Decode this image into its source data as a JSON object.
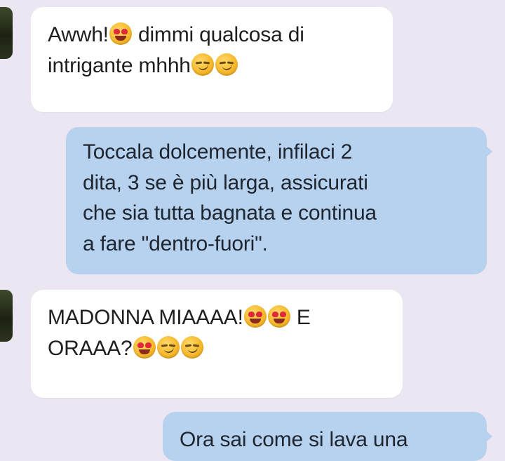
{
  "messages": [
    {
      "direction": "received",
      "lines": [
        [
          "Awwh!",
          "emoji:heart-eyes",
          " dimmi qualcosa di"
        ],
        [
          "intrigante mhhh",
          "emoji:smirk",
          "emoji:smirk"
        ]
      ]
    },
    {
      "direction": "sent",
      "lines": [
        [
          "Toccala dolcemente, infilaci 2"
        ],
        [
          "dita, 3 se è più larga, assicurati"
        ],
        [
          "che sia tutta bagnata e continua"
        ],
        [
          "a fare \"dentro-fuori\"."
        ]
      ]
    },
    {
      "direction": "received",
      "lines": [
        [
          "MADONNA MIAAAA!",
          "emoji:heart-eyes",
          "emoji:heart-eyes",
          " E"
        ],
        [
          "ORAAA?",
          "emoji:heart-eyes",
          "emoji:smirk",
          "emoji:smirk"
        ]
      ]
    },
    {
      "direction": "sent",
      "lines": [
        [
          "Ora sai come si lava una"
        ]
      ]
    }
  ],
  "colors": {
    "background": "#ebe6f1",
    "received_bubble": "#ffffff",
    "sent_bubble": "#b7d2ef",
    "text": "#1f1f1f"
  }
}
